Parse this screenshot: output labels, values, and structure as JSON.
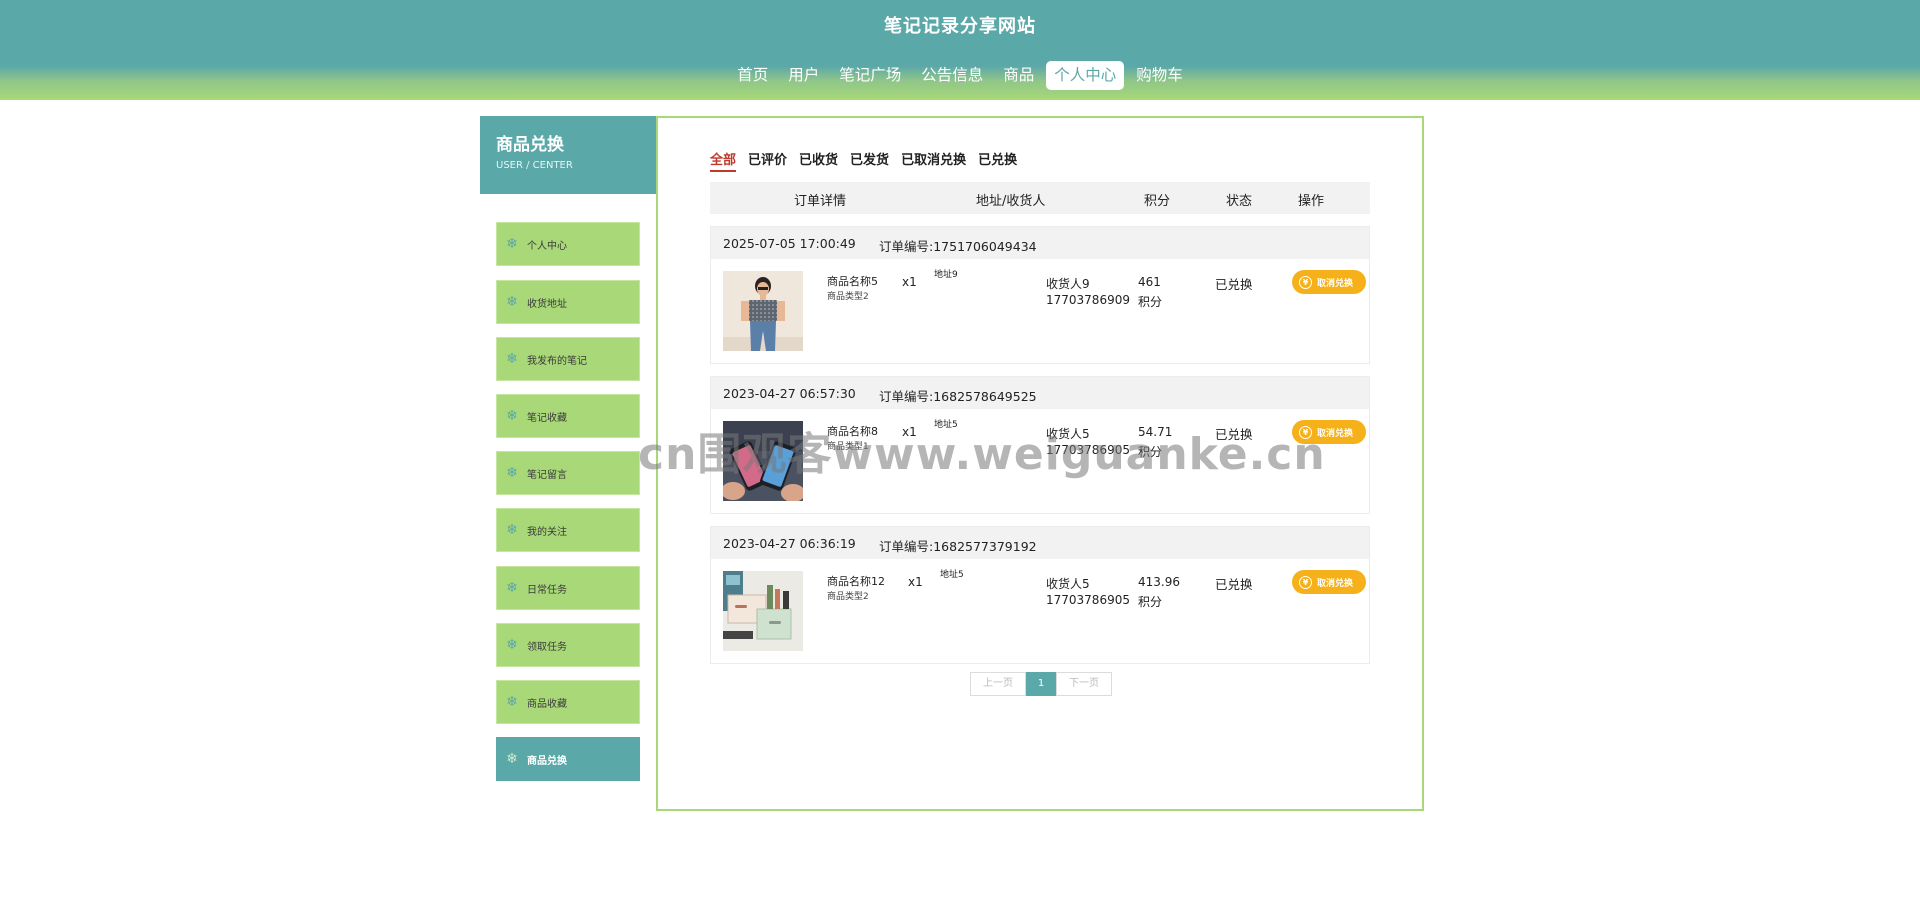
{
  "site": {
    "title": "笔记记录分享网站",
    "nav": [
      "首页",
      "用户",
      "笔记广场",
      "公告信息",
      "商品",
      "个人中心",
      "购物车"
    ],
    "active_nav_index": 5,
    "colors": {
      "primary": "#5ba8a8",
      "accent": "#a8d878",
      "button": "#f5b01a",
      "active_tab": "#c0392b"
    }
  },
  "sidebar": {
    "title": "商品兑换",
    "subtitle": "USER / CENTER",
    "items": [
      "个人中心",
      "收货地址",
      "我发布的笔记",
      "笔记收藏",
      "笔记留言",
      "我的关注",
      "日常任务",
      "领取任务",
      "商品收藏",
      "商品兑换"
    ],
    "active_index": 9,
    "icon": "snowflake-icon"
  },
  "tabs": {
    "items": [
      "全部",
      "已评价",
      "已收货",
      "已发货",
      "已取消兑换",
      "已兑换"
    ],
    "active_index": 0
  },
  "table": {
    "headers": [
      "订单详情",
      "地址/收货人",
      "积分",
      "状态",
      "操作"
    ]
  },
  "orders": [
    {
      "datetime": "2025-07-05 17:00:49",
      "order_no": "订单编号:1751706049434",
      "product_name": "商品名称5",
      "product_type": "商品类型2",
      "qty": "x1",
      "address": "地址9",
      "receiver": "收货人9",
      "phone": "17703786909",
      "points": "461",
      "points_unit": "积分",
      "status": "已兑换",
      "action": "取消兑换",
      "image": "woman-fashion-photo"
    },
    {
      "datetime": "2023-04-27 06:57:30",
      "order_no": "订单编号:1682578649525",
      "product_name": "商品名称8",
      "product_type": "商品类型1",
      "qty": "x1",
      "address": "地址5",
      "receiver": "收货人5",
      "phone": "17703786905",
      "points": "54.71",
      "points_unit": "积分",
      "status": "已兑换",
      "action": "取消兑换",
      "image": "smartphones-photo"
    },
    {
      "datetime": "2023-04-27 06:36:19",
      "order_no": "订单编号:1682577379192",
      "product_name": "商品名称12",
      "product_type": "商品类型2",
      "qty": "x1",
      "address": "地址5",
      "receiver": "收货人5",
      "phone": "17703786905",
      "points": "413.96",
      "points_unit": "积分",
      "status": "已兑换",
      "action": "取消兑换",
      "image": "storage-boxes-photo"
    }
  ],
  "pager": {
    "prev": "上一页",
    "current": "1",
    "next": "下一页"
  },
  "watermark": "cn围观客www.weiguanke.cn"
}
